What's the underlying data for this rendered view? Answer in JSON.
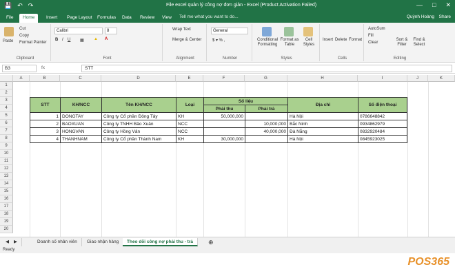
{
  "window": {
    "title": "File excel quản lý công nợ đơn giản - Excel (Product Activation Failed)",
    "user": "Quỳnh Hoàng",
    "share": "Share"
  },
  "tabs": [
    "File",
    "Home",
    "Insert",
    "Page Layout",
    "Formulas",
    "Data",
    "Review",
    "View"
  ],
  "tell_me": "Tell me what you want to do...",
  "ribbon": {
    "clipboard": {
      "label": "Clipboard",
      "paste": "Paste",
      "cut": "Cut",
      "copy": "Copy",
      "format_painter": "Format Painter"
    },
    "font": {
      "label": "Font",
      "family": "Calibri",
      "size": "8"
    },
    "alignment": {
      "label": "Alignment",
      "wrap": "Wrap Text",
      "merge": "Merge & Center"
    },
    "number": {
      "label": "Number",
      "format": "General"
    },
    "styles": {
      "label": "Styles",
      "conditional": "Conditional Formatting",
      "format_table": "Format as Table",
      "cell_styles": "Cell Styles"
    },
    "cells": {
      "label": "Cells",
      "insert": "Insert",
      "delete": "Delete",
      "format": "Format"
    },
    "editing": {
      "label": "Editing",
      "autosum": "AutoSum",
      "fill": "Fill",
      "clear": "Clear",
      "sort": "Sort & Filter",
      "find": "Find & Select"
    }
  },
  "formula_bar": {
    "name_box": "B3",
    "fx": "fx",
    "content": "STT"
  },
  "columns": [
    "A",
    "B",
    "C",
    "D",
    "E",
    "F",
    "G",
    "H",
    "I",
    "J",
    "K"
  ],
  "rows": [
    "1",
    "2",
    "3",
    "4",
    "5",
    "6",
    "7",
    "8",
    "9",
    "10",
    "11",
    "12",
    "13",
    "14",
    "15",
    "16",
    "17",
    "18",
    "19",
    "20"
  ],
  "table": {
    "headers": {
      "stt": "STT",
      "khncc": "KH/NCC",
      "ten": "Tên KH/NCC",
      "loai": "Loại",
      "so_lieu": "Số liệu",
      "phai_thu": "Phải thu",
      "phai_tra": "Phải trả",
      "dia_chi": "Địa chỉ",
      "sdt": "Số điện thoại"
    },
    "rows": [
      {
        "stt": "1",
        "code": "DONGTAY",
        "name": "Công ty Cổ phần Đông Tây",
        "type": "KH",
        "thu": "50,000,000",
        "tra": "",
        "addr": "Hà Nội",
        "phone": "0786648842"
      },
      {
        "stt": "2",
        "code": "BAOXUAN",
        "name": "Công ty TNHH Bảo Xuân",
        "type": "NCC",
        "thu": "",
        "tra": "10,000,000",
        "addr": "Bắc Ninh",
        "phone": "0934862979"
      },
      {
        "stt": "3",
        "code": "HONGVAN",
        "name": "Công ty Hồng Vân",
        "type": "NCC",
        "thu": "",
        "tra": "40,000,000",
        "addr": "Đà Nẵng",
        "phone": "0832920484"
      },
      {
        "stt": "4",
        "code": "THANHNAM",
        "name": "Công ty Cổ phần Thành Nam",
        "type": "KH",
        "thu": "30,000,000",
        "tra": "",
        "addr": "Hà Nội",
        "phone": "0845923025"
      }
    ]
  },
  "sheets": [
    "Doanh số nhân viên",
    "Giao nhận hàng",
    "Theo dõi công nợ phải thu - trả"
  ],
  "status": "Ready",
  "watermark": {
    "pos": "POS",
    "num": "365"
  }
}
